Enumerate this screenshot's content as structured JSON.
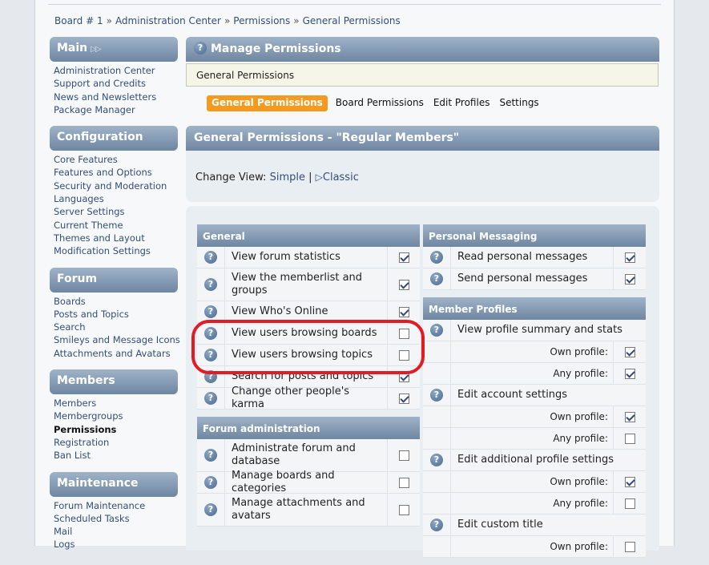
{
  "breadcrumb": [
    "Board # 1",
    "Administration Center",
    "Permissions",
    "General Permissions"
  ],
  "sidebar": [
    {
      "title": "Main",
      "items": [
        "Administration Center",
        "Support and Credits",
        "News and Newsletters",
        "Package Manager"
      ]
    },
    {
      "title": "Configuration",
      "items": [
        "Core Features",
        "Features and Options",
        "Security and Moderation",
        "Languages",
        "Server Settings",
        "Current Theme",
        "Themes and Layout",
        "Modification Settings"
      ]
    },
    {
      "title": "Forum",
      "items": [
        "Boards",
        "Posts and Topics",
        "Search",
        "Smileys and Message Icons",
        "Attachments and Avatars"
      ]
    },
    {
      "title": "Members",
      "items": [
        "Members",
        "Membergroups",
        "Permissions",
        "Registration",
        "Ban List"
      ],
      "active": "Permissions"
    },
    {
      "title": "Maintenance",
      "items": [
        "Forum Maintenance",
        "Scheduled Tasks",
        "Mail",
        "Logs"
      ]
    }
  ],
  "header": {
    "title": "Manage Permissions",
    "description": "General Permissions"
  },
  "tabs": [
    "General Permissions",
    "Board Permissions",
    "Edit Profiles",
    "Settings"
  ],
  "section_title": "General Permissions - \"Regular Members\"",
  "view": {
    "label": "Change View:",
    "simple": "Simple",
    "separator": "|",
    "classic": "Classic"
  },
  "left_columns": [
    {
      "title": "General",
      "rows": [
        {
          "label": "View forum statistics",
          "checked": true
        },
        {
          "label": "View the memberlist and groups",
          "checked": true
        },
        {
          "label": "View Who's Online",
          "checked": true
        },
        {
          "label": "View users browsing boards",
          "checked": false
        },
        {
          "label": "View users browsing topics",
          "checked": false
        },
        {
          "label": "Search for posts and topics",
          "checked": true
        },
        {
          "label": "Change other people's karma",
          "checked": true
        }
      ]
    },
    {
      "title": "Forum administration",
      "rows": [
        {
          "label": "Administrate forum and database",
          "checked": false
        },
        {
          "label": "Manage boards and categories",
          "checked": false
        },
        {
          "label": "Manage attachments and avatars",
          "checked": false
        }
      ]
    }
  ],
  "right_columns": [
    {
      "title": "Personal Messaging",
      "rows": [
        {
          "label": "Read personal messages",
          "checked": true
        },
        {
          "label": "Send personal messages",
          "checked": true
        }
      ]
    },
    {
      "title": "Member Profiles",
      "rows": [
        {
          "label": "View profile summary and stats"
        },
        {
          "label": "Own profile:",
          "sub": true,
          "checked": true
        },
        {
          "label": "Any profile:",
          "sub": true,
          "checked": true
        },
        {
          "label": "Edit account settings"
        },
        {
          "label": "Own profile:",
          "sub": true,
          "checked": true
        },
        {
          "label": "Any profile:",
          "sub": true,
          "checked": false
        },
        {
          "label": "Edit additional profile settings"
        },
        {
          "label": "Own profile:",
          "sub": true,
          "checked": true
        },
        {
          "label": "Any profile:",
          "sub": true,
          "checked": false
        },
        {
          "label": "Edit custom title"
        },
        {
          "label": "Own profile:",
          "sub": true,
          "checked": false
        }
      ]
    }
  ],
  "colors": {
    "accent_tab": "#f39a1f",
    "header_gradient_top": "#9fb3c8",
    "header_gradient_bottom": "#6f86a1",
    "highlight": "#e01d24",
    "link": "#334f7a"
  }
}
